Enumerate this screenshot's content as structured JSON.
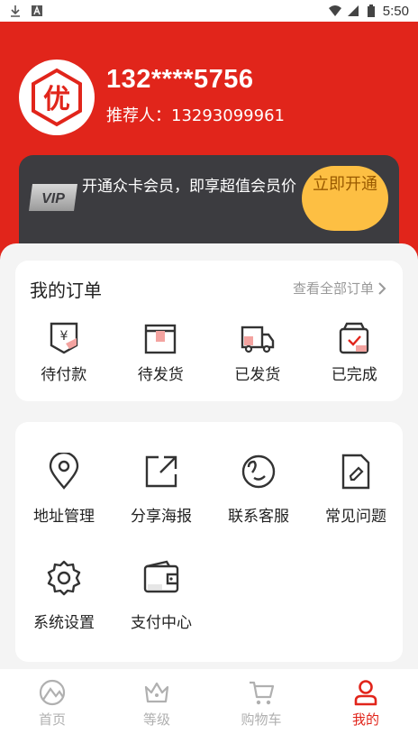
{
  "status_bar": {
    "time": "5:50",
    "left_icons": [
      "download-icon",
      "notification-a-icon"
    ],
    "right_icons": [
      "wifi-icon",
      "signal-icon",
      "battery-icon"
    ]
  },
  "profile": {
    "avatar_text": "优",
    "phone": "132****5756",
    "referrer": "推荐人：13293099961"
  },
  "vip": {
    "badge": "VIP",
    "text": "开通众卡会员，即享超值会员价",
    "button_label": "立即开通"
  },
  "orders": {
    "title": "我的订单",
    "view_all": "查看全部订单",
    "items": [
      {
        "label": "待付款",
        "icon": "wallet-payment-icon"
      },
      {
        "label": "待发货",
        "icon": "package-box-icon"
      },
      {
        "label": "已发货",
        "icon": "delivery-truck-icon"
      },
      {
        "label": "已完成",
        "icon": "completed-bag-icon"
      }
    ]
  },
  "tools": {
    "items": [
      {
        "label": "地址管理",
        "icon": "location-pin-icon"
      },
      {
        "label": "分享海报",
        "icon": "share-icon"
      },
      {
        "label": "联系客服",
        "icon": "customer-service-icon"
      },
      {
        "label": "常见问题",
        "icon": "document-edit-icon"
      },
      {
        "label": "系统设置",
        "icon": "gear-icon"
      },
      {
        "label": "支付中心",
        "icon": "wallet-icon"
      }
    ]
  },
  "tabbar": {
    "items": [
      {
        "label": "首页",
        "icon": "home-icon",
        "active": false
      },
      {
        "label": "等级",
        "icon": "crown-icon",
        "active": false
      },
      {
        "label": "购物车",
        "icon": "cart-icon",
        "active": false
      },
      {
        "label": "我的",
        "icon": "user-icon",
        "active": true
      }
    ]
  },
  "colors": {
    "brand_red": "#e1251b",
    "vip_card": "#3c3c40",
    "vip_button": "#fdbf43",
    "inactive_tab": "#b0b0b0"
  }
}
